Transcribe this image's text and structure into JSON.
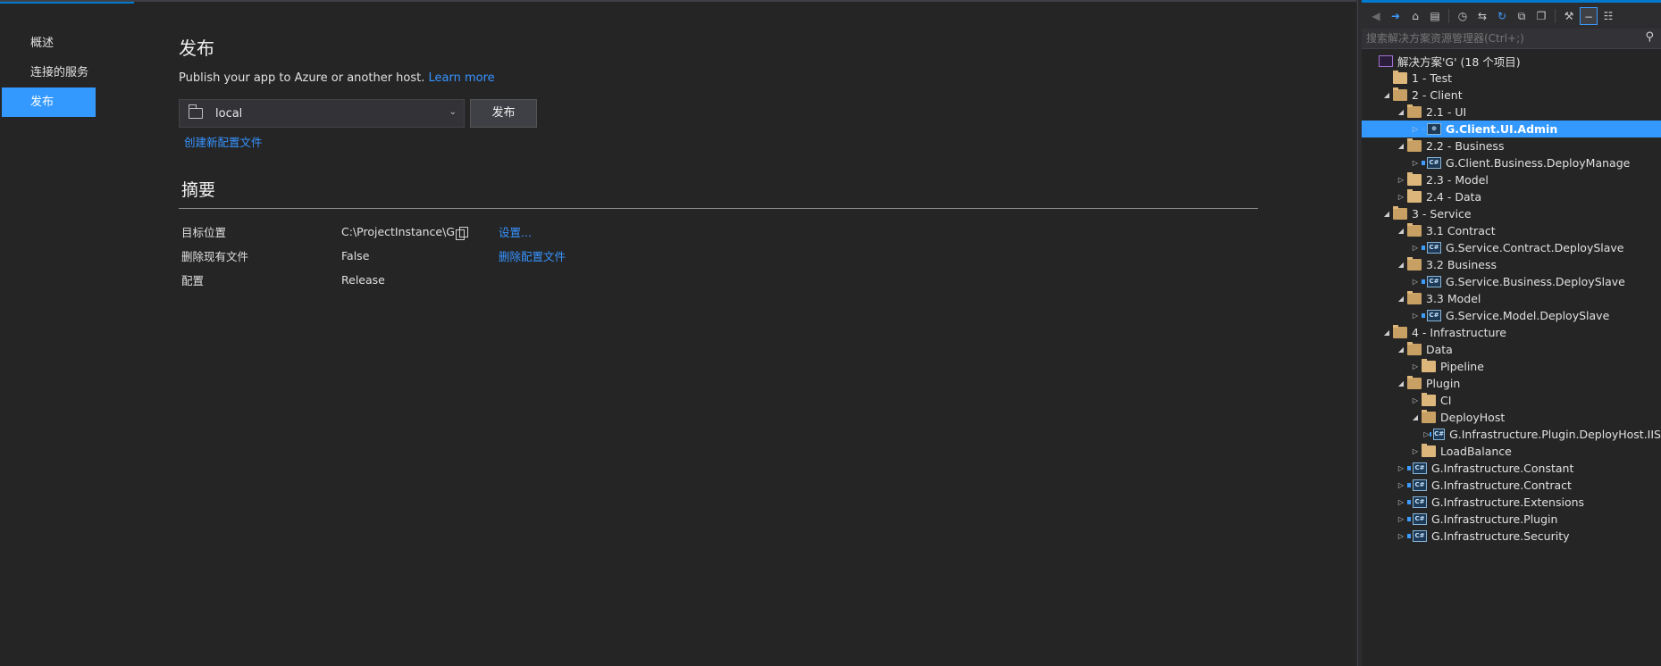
{
  "left_nav": {
    "items": [
      {
        "label": "概述",
        "active": false
      },
      {
        "label": "连接的服务",
        "active": false
      },
      {
        "label": "发布",
        "active": true
      }
    ]
  },
  "publish": {
    "title": "发布",
    "subtitle": "Publish your app to Azure or another host.",
    "learn_more": "Learn more",
    "profile_value": "local",
    "publish_button": "发布",
    "create_profile_link": "创建新配置文件"
  },
  "summary": {
    "title": "摘要",
    "rows": [
      {
        "label": "目标位置",
        "value": "C:\\ProjectInstance\\G",
        "action": "设置..."
      },
      {
        "label": "删除现有文件",
        "value": "False",
        "action": "删除配置文件"
      },
      {
        "label": "配置",
        "value": "Release",
        "action": ""
      }
    ]
  },
  "solution_explorer": {
    "search_placeholder": "搜索解决方案资源管理器(Ctrl+;)",
    "toolbar_icons": [
      "back-icon",
      "forward-icon",
      "home-icon",
      "switch-views-icon",
      "pending-changes-icon",
      "sync-icon",
      "refresh-icon",
      "collapse-all-icon",
      "show-all-files-icon",
      "properties-icon",
      "preview-icon",
      "class-view-icon"
    ],
    "tree": [
      {
        "label": "解决方案'G' (18 个项目)",
        "level": 0,
        "kind": "solution",
        "expander": ""
      },
      {
        "label": "1 - Test",
        "level": 1,
        "kind": "folder",
        "expander": ""
      },
      {
        "label": "2 - Client",
        "level": 1,
        "kind": "folder-open",
        "expander": "open"
      },
      {
        "label": "2.1 - UI",
        "level": 2,
        "kind": "folder-open",
        "expander": "open"
      },
      {
        "label": "G.Client.UI.Admin",
        "level": 3,
        "kind": "web-project",
        "expander": "closed",
        "selected": true
      },
      {
        "label": "2.2 - Business",
        "level": 2,
        "kind": "folder-open",
        "expander": "open"
      },
      {
        "label": "G.Client.Business.DeployManage",
        "level": 3,
        "kind": "project",
        "expander": "closed"
      },
      {
        "label": "2.3 - Model",
        "level": 2,
        "kind": "folder",
        "expander": "closed"
      },
      {
        "label": "2.4 - Data",
        "level": 2,
        "kind": "folder",
        "expander": "closed"
      },
      {
        "label": "3 - Service",
        "level": 1,
        "kind": "folder-open",
        "expander": "open"
      },
      {
        "label": "3.1 Contract",
        "level": 2,
        "kind": "folder-open",
        "expander": "open"
      },
      {
        "label": "G.Service.Contract.DeploySlave",
        "level": 3,
        "kind": "project",
        "expander": "closed"
      },
      {
        "label": "3.2 Business",
        "level": 2,
        "kind": "folder-open",
        "expander": "open"
      },
      {
        "label": "G.Service.Business.DeploySlave",
        "level": 3,
        "kind": "project",
        "expander": "closed"
      },
      {
        "label": "3.3 Model",
        "level": 2,
        "kind": "folder-open",
        "expander": "open"
      },
      {
        "label": "G.Service.Model.DeploySlave",
        "level": 3,
        "kind": "project",
        "expander": "closed"
      },
      {
        "label": "4 - Infrastructure",
        "level": 1,
        "kind": "folder-open",
        "expander": "open"
      },
      {
        "label": "Data",
        "level": 2,
        "kind": "folder-open",
        "expander": "open"
      },
      {
        "label": "Pipeline",
        "level": 3,
        "kind": "folder",
        "expander": "closed"
      },
      {
        "label": "Plugin",
        "level": 2,
        "kind": "folder-open",
        "expander": "open"
      },
      {
        "label": "CI",
        "level": 3,
        "kind": "folder",
        "expander": "closed"
      },
      {
        "label": "DeployHost",
        "level": 3,
        "kind": "folder-open",
        "expander": "open"
      },
      {
        "label": "G.Infrastructure.Plugin.DeployHost.IIS",
        "level": 4,
        "kind": "project",
        "expander": "closed"
      },
      {
        "label": "LoadBalance",
        "level": 3,
        "kind": "folder",
        "expander": "closed"
      },
      {
        "label": "G.Infrastructure.Constant",
        "level": 2,
        "kind": "project",
        "expander": "closed"
      },
      {
        "label": "G.Infrastructure.Contract",
        "level": 2,
        "kind": "project",
        "expander": "closed"
      },
      {
        "label": "G.Infrastructure.Extensions",
        "level": 2,
        "kind": "project",
        "expander": "closed"
      },
      {
        "label": "G.Infrastructure.Plugin",
        "level": 2,
        "kind": "project",
        "expander": "closed"
      },
      {
        "label": "G.Infrastructure.Security",
        "level": 2,
        "kind": "project",
        "expander": "closed"
      }
    ]
  }
}
